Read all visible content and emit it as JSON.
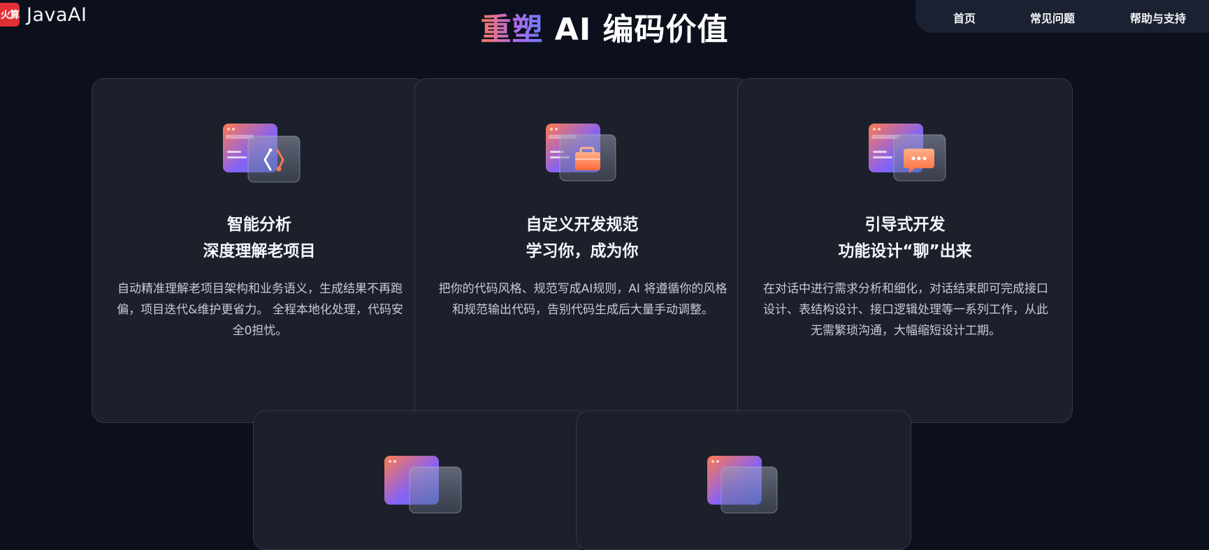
{
  "header": {
    "logo_badge": "火算",
    "logo_text": "JavaAI",
    "nav": [
      {
        "label": "首页"
      },
      {
        "label": "常见问题"
      },
      {
        "label": "帮助与支持"
      }
    ]
  },
  "section": {
    "title_highlight": "重塑",
    "title_rest": "AI 编码价值"
  },
  "cards": [
    {
      "icon": "code-hexagon-icon",
      "title_line1": "智能分析",
      "title_line2": "深度理解老项目",
      "description": "自动精准理解老项目架构和业务语义，生成结果不再跑偏，项目迭代&维护更省力。 全程本地化处理，代码安全0担忧。"
    },
    {
      "icon": "briefcase-icon",
      "title_line1": "自定义开发规范",
      "title_line2": "学习你，成为你",
      "description": "把你的代码风格、规范写成AI规则，AI 将遵循你的风格和规范输出代码，告别代码生成后大量手动调整。"
    },
    {
      "icon": "chat-bubble-icon",
      "title_line1": "引导式开发",
      "title_line2": "功能设计“聊”出来",
      "description": "在对话中进行需求分析和细化，对话结束即可完成接口设计、表结构设计、接口逻辑处理等一系列工作，从此无需繁琐沟通，大幅缩短设计工期。"
    }
  ],
  "colors": {
    "background": "#0b101c",
    "card": "#1c202b",
    "accent_orange": "#ff7a59",
    "accent_blue": "#5b6cff"
  }
}
